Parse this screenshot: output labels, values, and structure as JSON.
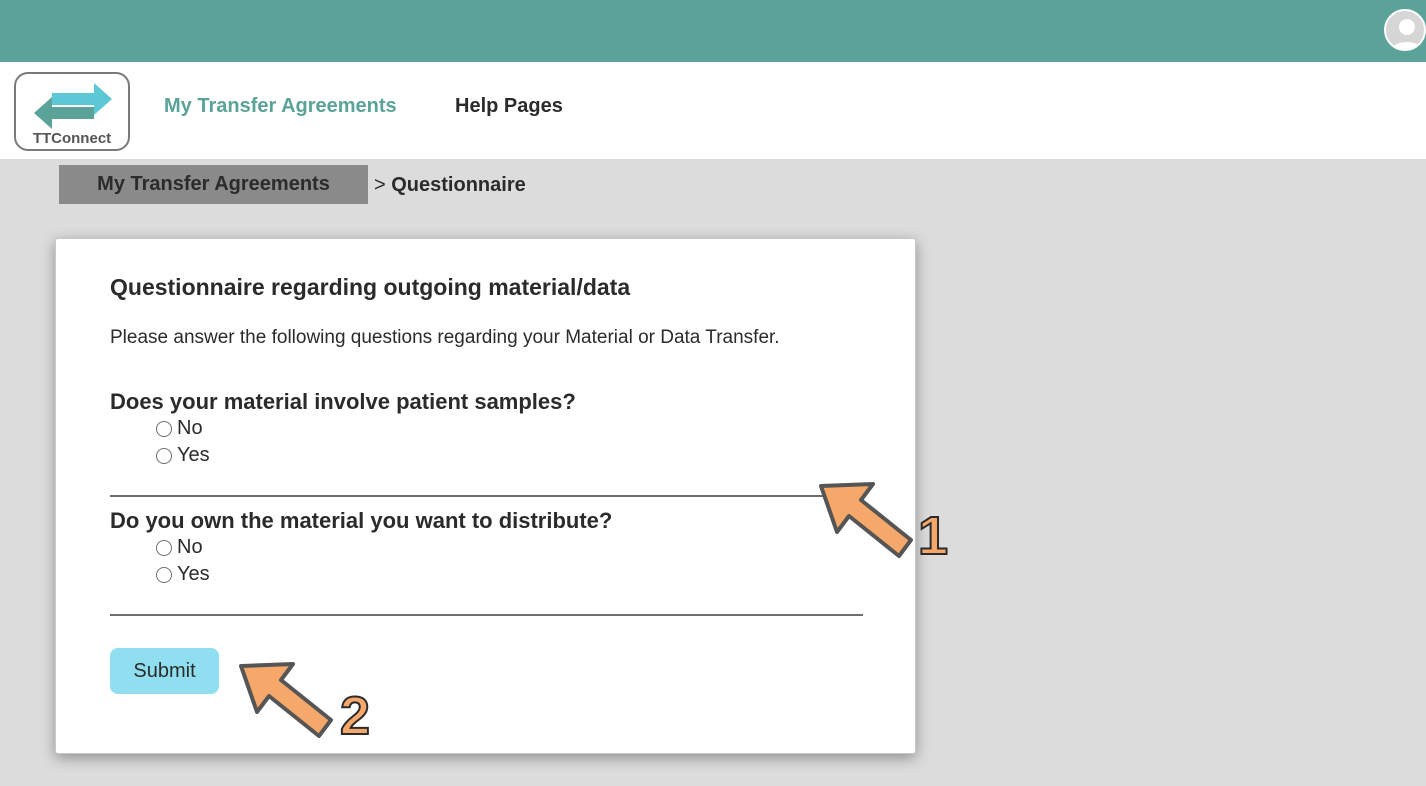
{
  "header": {
    "logo_text": "TTConnect",
    "nav": [
      {
        "label": "My Transfer Agreements"
      },
      {
        "label": "Help Pages"
      }
    ]
  },
  "breadcrumb": {
    "parent": "My Transfer Agreements",
    "separator": ">",
    "current": "Questionnaire"
  },
  "form": {
    "title": "Questionnaire regarding outgoing material/data",
    "intro": "Please answer the following questions regarding your Material or Data Transfer.",
    "questions": [
      {
        "text": "Does your material involve patient samples?",
        "options": [
          "No",
          "Yes"
        ]
      },
      {
        "text": "Do you own the material you want to distribute?",
        "options": [
          "No",
          "Yes"
        ]
      }
    ],
    "submit_label": "Submit"
  },
  "annotations": [
    {
      "label": "1"
    },
    {
      "label": "2"
    }
  ],
  "colors": {
    "brand_teal": "#5ba398",
    "content_bg": "#dcdcdc",
    "submit_bg": "#8fdff0",
    "arrow_fill": "#f5a86a"
  }
}
